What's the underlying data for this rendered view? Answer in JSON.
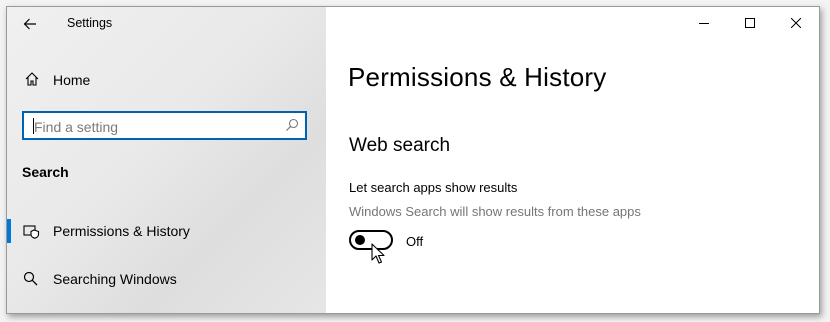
{
  "window": {
    "title": "Settings"
  },
  "sidebar": {
    "home_label": "Home",
    "search": {
      "placeholder": "Find a setting"
    },
    "section_heading": "Search",
    "items": [
      {
        "label": "Permissions & History",
        "icon": "shield-search-icon",
        "selected": true
      },
      {
        "label": "Searching Windows",
        "icon": "search-icon",
        "selected": false
      }
    ]
  },
  "content": {
    "page_title": "Permissions & History",
    "group_title": "Web search",
    "setting": {
      "label": "Let search apps show results",
      "description": "Windows Search will show results from these apps",
      "toggle_state": "Off"
    }
  },
  "colors": {
    "accent": "#0078d7",
    "search_border": "#0063b1",
    "description_text": "#767676"
  }
}
